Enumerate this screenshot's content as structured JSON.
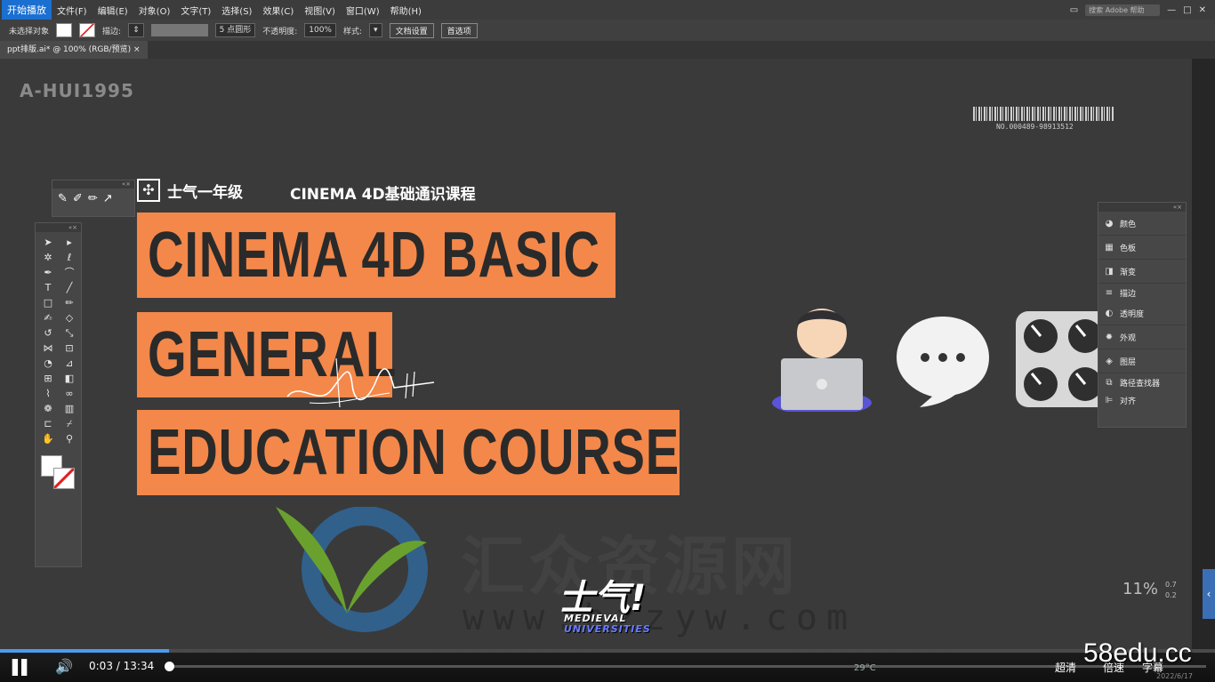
{
  "menubar": {
    "start_label": "开始播放",
    "items": [
      "文件(F)",
      "编辑(E)",
      "对象(O)",
      "文字(T)",
      "选择(S)",
      "效果(C)",
      "视图(V)",
      "窗口(W)",
      "帮助(H)"
    ],
    "search_placeholder": "搜索 Adobe 帮助"
  },
  "ctrlbar": {
    "selection_label": "未选择对象",
    "stroke_label": "描边:",
    "brush_label": "5 点圆形",
    "opacity_label": "不透明度:",
    "opacity_value": "100%",
    "style_label": "样式:",
    "doc_setup": "文档设置",
    "prefs": "首选项"
  },
  "tabbar": {
    "doc_tab": "ppt排版.ai* @ 100% (RGB/预览)",
    "close": "×"
  },
  "canvas": {
    "watermark_tag": "A-HUI1995",
    "barcode_number": "NO.000489-98913512",
    "brand": "士气一年级",
    "course_cn": "CINEMA 4D基础通识课程",
    "title_line1": "CINEMA 4D BASIC",
    "title_line2": "GENERAL",
    "title_line3": "EDUCATION COURSE",
    "overlay_cn": "汇众资源网",
    "overlay_url": "www.hzzyw.com",
    "overlay_logo": "士气!",
    "overlay_medieval": "MEDIEVAL",
    "overlay_universities": "UNIVERSITIES",
    "zoom_corner": "11%",
    "zoom_corner_a": "0.7",
    "zoom_corner_b": "0.2"
  },
  "right_panel": {
    "items": [
      {
        "icon": "color-icon",
        "label": "颜色"
      },
      {
        "icon": "swatches-icon",
        "label": "色板"
      },
      {
        "icon": "gradient-icon",
        "label": "渐变"
      },
      {
        "icon": "stroke-icon",
        "label": "描边"
      },
      {
        "icon": "transparency-icon",
        "label": "透明度"
      },
      {
        "icon": "appearance-icon",
        "label": "外观"
      },
      {
        "icon": "layers-icon",
        "label": "图层"
      },
      {
        "icon": "pathfinder-icon",
        "label": "路径查找器"
      },
      {
        "icon": "align-icon",
        "label": "对齐"
      }
    ]
  },
  "statusbar": {
    "zoom": "100%"
  },
  "player": {
    "time_current": "0:03",
    "time_sep": "/",
    "time_total": "13:34",
    "weather": "29°C",
    "quality": "超清",
    "speed": "倍速",
    "subtitle": "字幕",
    "date": "2022/6/17"
  },
  "site_watermark": "58edu.cc",
  "colors": {
    "banner": "#f3884a",
    "canvas": "#3a3a3a",
    "accent": "#4a9cf0"
  }
}
